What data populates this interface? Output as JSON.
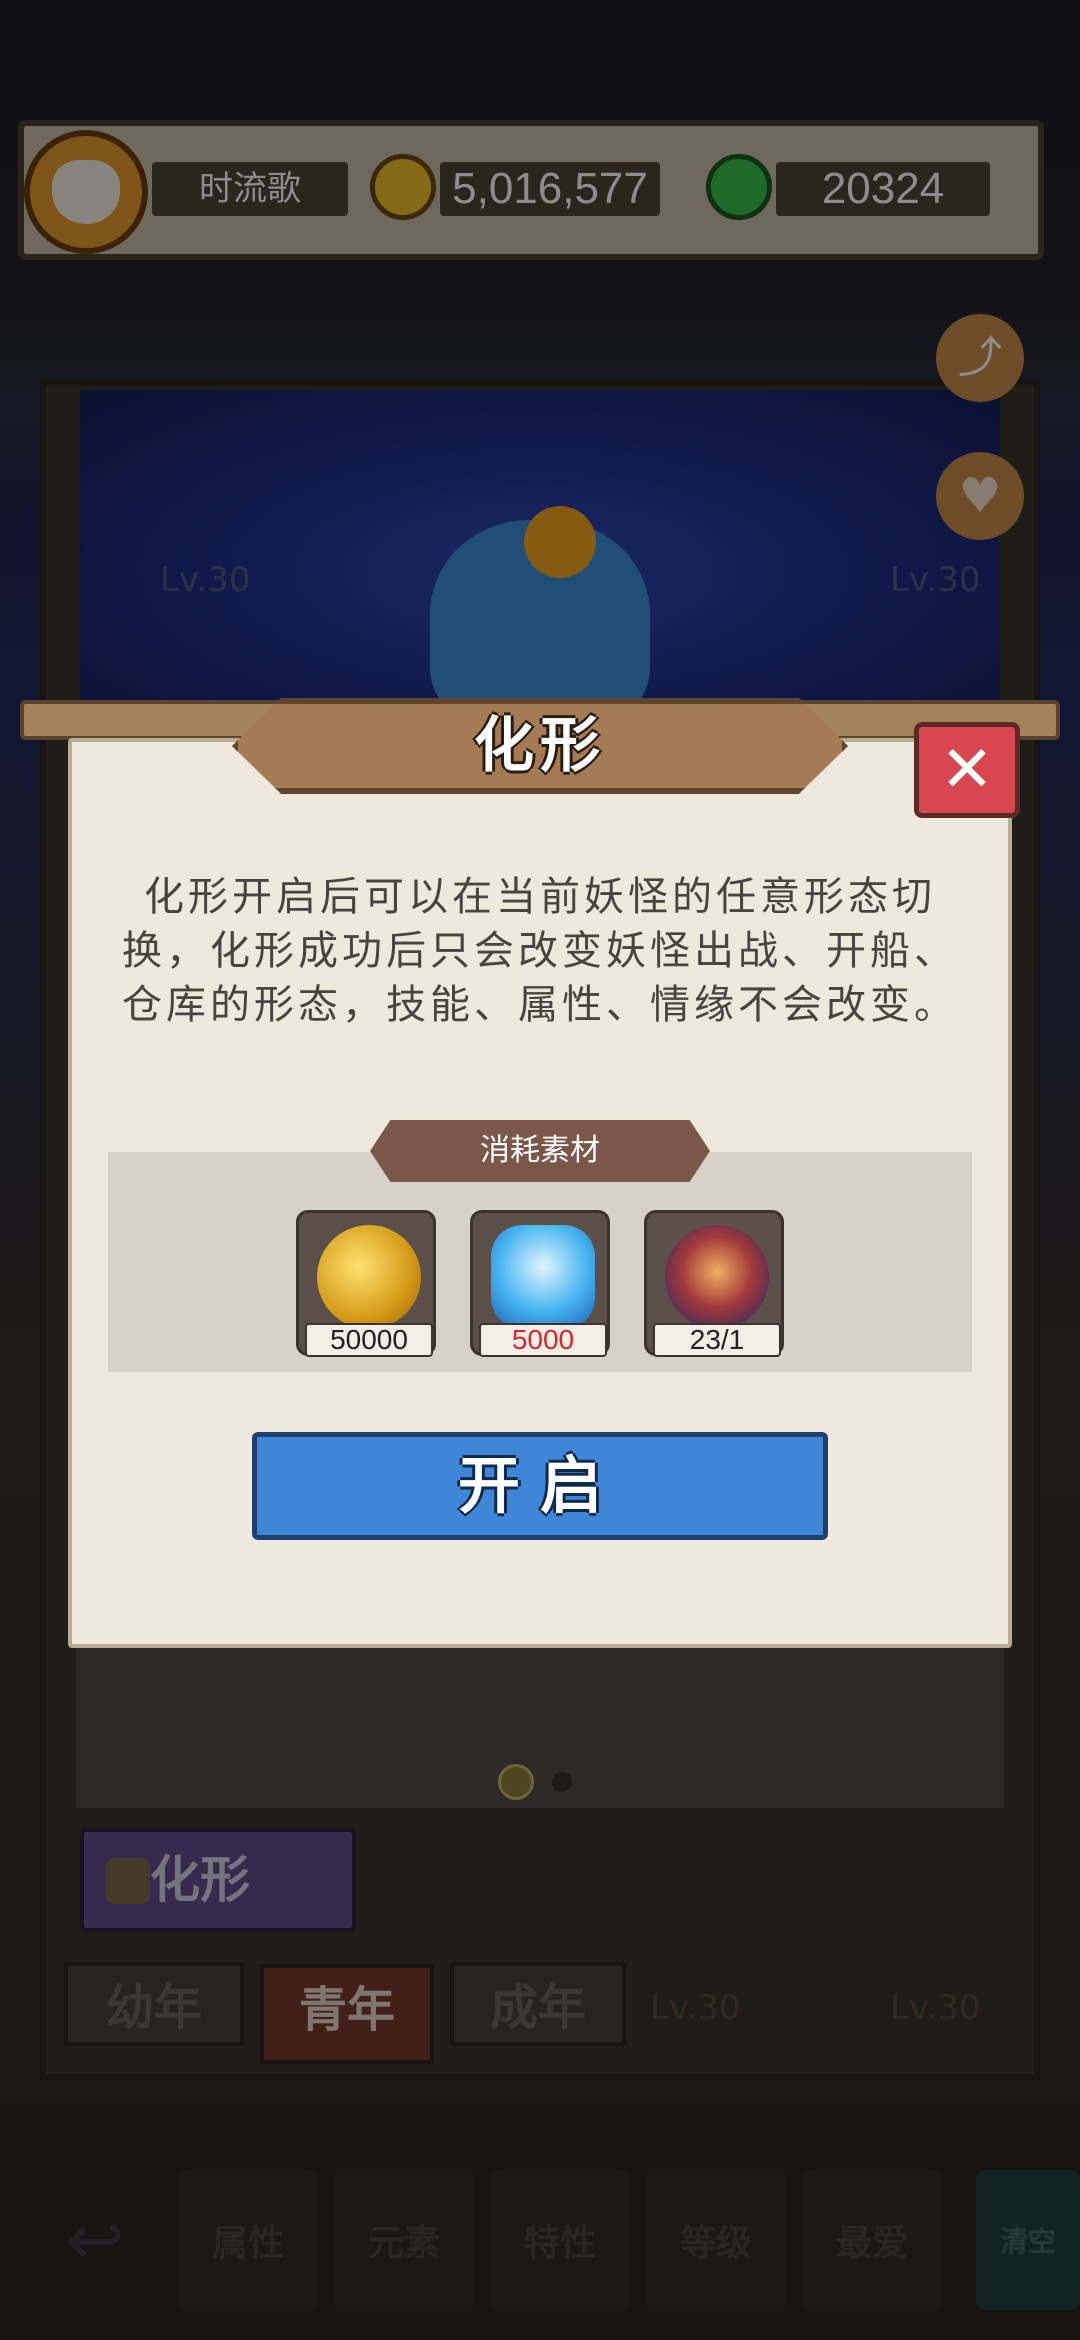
{
  "top_bar": {
    "player_name": "时流歌",
    "coins": "5,016,577",
    "jade": "20324"
  },
  "background": {
    "level_left": "Lv.30",
    "level_right": "Lv.30",
    "level_bottom_1": "Lv.30",
    "level_bottom_2": "Lv.30"
  },
  "modal": {
    "title": "化形",
    "close_icon": "close-icon",
    "description": "化形开启后可以在当前妖怪的任意形态切换，化形成功后只会改变妖怪出战、开船、仓库的形态，技能、属性、情缘不会改变。",
    "materials_label": "消耗素材",
    "materials": [
      {
        "icon": "gold-coins-icon",
        "count": "50000",
        "count_color": "#222222"
      },
      {
        "icon": "blue-crystal-icon",
        "count": "5000",
        "count_color": "#d8262d"
      },
      {
        "icon": "spirit-orb-icon",
        "count": "23/1",
        "count_color": "#222222"
      }
    ],
    "open_button": "开启"
  },
  "panel": {
    "morph_tab": "化形",
    "age_tabs": [
      "幼年",
      "青年",
      "成年"
    ],
    "active_age_tab": "青年",
    "pager_dots": 2,
    "active_dot": 0
  },
  "bottom_nav": [
    "属性",
    "元素",
    "特性",
    "等级",
    "最爱",
    "清空"
  ]
}
